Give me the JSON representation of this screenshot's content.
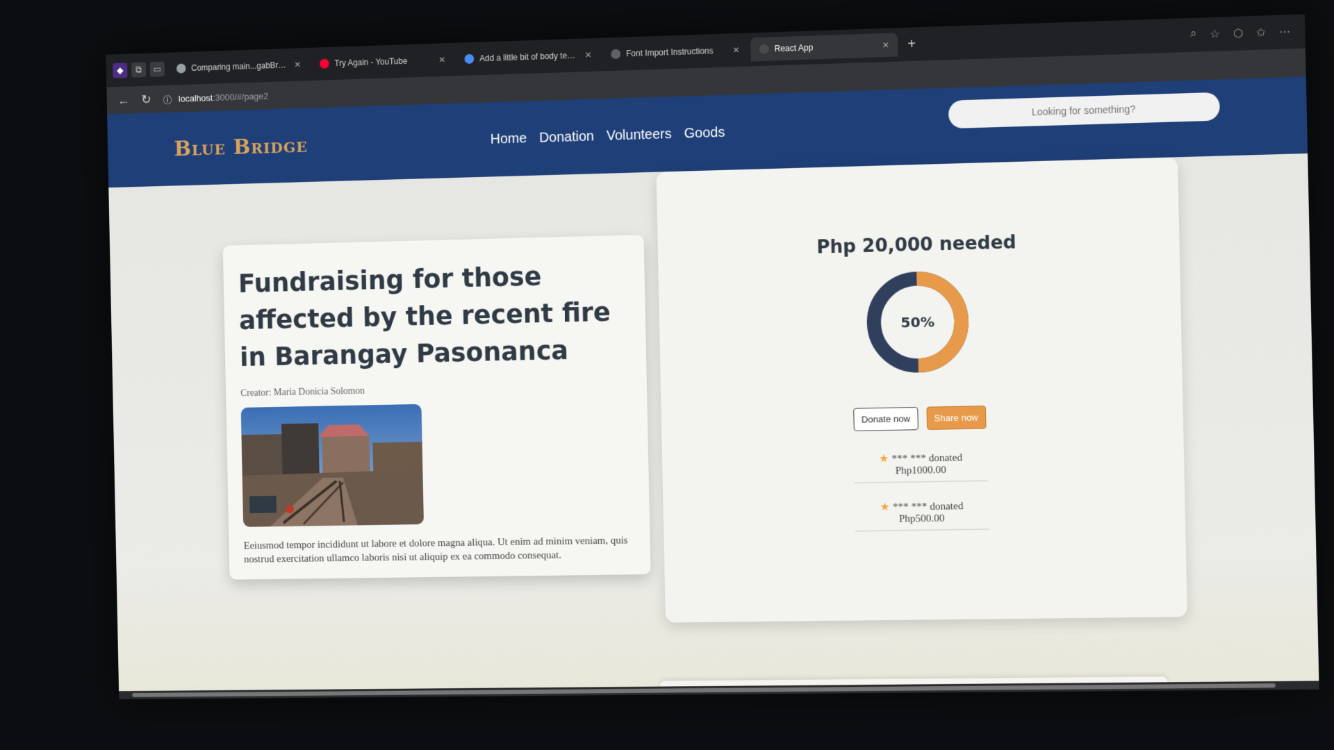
{
  "browser": {
    "tabs": [
      {
        "title": "Comparing main...gabBranch · O",
        "color": "#9aa0a6",
        "active": false
      },
      {
        "title": "Try Again - YouTube",
        "color": "#ff0033",
        "active": false
      },
      {
        "title": "Add a little bit of body text - 20",
        "color": "#4c8bf5",
        "active": false
      },
      {
        "title": "Font Import Instructions",
        "color": "#5f6368",
        "active": false
      },
      {
        "title": "React App",
        "color": "#4a4a4a",
        "active": true
      }
    ],
    "url_host": "localhost",
    "url_path": ":3000/#/page2"
  },
  "navbar": {
    "logo": "Blue Bridge",
    "links": [
      "Home",
      "Donation",
      "Volunteers",
      "Goods"
    ],
    "search_placeholder": "Looking for something?"
  },
  "campaign": {
    "title": "Fundraising for those affected by the recent fire in Barangay Pasonanca",
    "creator": "Creator: Maria Donicia Solomon",
    "description": "Eeiusmod tempor incididunt ut labore et dolore magna aliqua. Ut enim ad minim veniam, quis nostrud exercitation ullamco laboris nisi ut aliquip ex ea commodo consequat."
  },
  "progress": {
    "needed": "Php 20,000 needed",
    "percent_label": "50%",
    "fraction": 0.5,
    "color_filled": "#e69a4a",
    "color_remaining": "#2f3f5c"
  },
  "actions": {
    "donate": "Donate now",
    "share": "Share now"
  },
  "donations": [
    {
      "who": "*** *** donated",
      "amount": "Php1000.00"
    },
    {
      "who": "*** *** donated",
      "amount": "Php500.00"
    }
  ]
}
